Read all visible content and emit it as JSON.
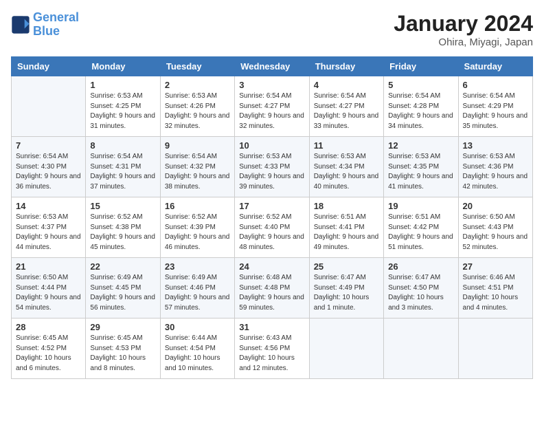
{
  "header": {
    "logo_line1": "General",
    "logo_line2": "Blue",
    "title": "January 2024",
    "subtitle": "Ohira, Miyagi, Japan"
  },
  "days_of_week": [
    "Sunday",
    "Monday",
    "Tuesday",
    "Wednesday",
    "Thursday",
    "Friday",
    "Saturday"
  ],
  "weeks": [
    [
      {
        "num": "",
        "sunrise": "",
        "sunset": "",
        "daylight": ""
      },
      {
        "num": "1",
        "sunrise": "Sunrise: 6:53 AM",
        "sunset": "Sunset: 4:25 PM",
        "daylight": "Daylight: 9 hours and 31 minutes."
      },
      {
        "num": "2",
        "sunrise": "Sunrise: 6:53 AM",
        "sunset": "Sunset: 4:26 PM",
        "daylight": "Daylight: 9 hours and 32 minutes."
      },
      {
        "num": "3",
        "sunrise": "Sunrise: 6:54 AM",
        "sunset": "Sunset: 4:27 PM",
        "daylight": "Daylight: 9 hours and 32 minutes."
      },
      {
        "num": "4",
        "sunrise": "Sunrise: 6:54 AM",
        "sunset": "Sunset: 4:27 PM",
        "daylight": "Daylight: 9 hours and 33 minutes."
      },
      {
        "num": "5",
        "sunrise": "Sunrise: 6:54 AM",
        "sunset": "Sunset: 4:28 PM",
        "daylight": "Daylight: 9 hours and 34 minutes."
      },
      {
        "num": "6",
        "sunrise": "Sunrise: 6:54 AM",
        "sunset": "Sunset: 4:29 PM",
        "daylight": "Daylight: 9 hours and 35 minutes."
      }
    ],
    [
      {
        "num": "7",
        "sunrise": "Sunrise: 6:54 AM",
        "sunset": "Sunset: 4:30 PM",
        "daylight": "Daylight: 9 hours and 36 minutes."
      },
      {
        "num": "8",
        "sunrise": "Sunrise: 6:54 AM",
        "sunset": "Sunset: 4:31 PM",
        "daylight": "Daylight: 9 hours and 37 minutes."
      },
      {
        "num": "9",
        "sunrise": "Sunrise: 6:54 AM",
        "sunset": "Sunset: 4:32 PM",
        "daylight": "Daylight: 9 hours and 38 minutes."
      },
      {
        "num": "10",
        "sunrise": "Sunrise: 6:53 AM",
        "sunset": "Sunset: 4:33 PM",
        "daylight": "Daylight: 9 hours and 39 minutes."
      },
      {
        "num": "11",
        "sunrise": "Sunrise: 6:53 AM",
        "sunset": "Sunset: 4:34 PM",
        "daylight": "Daylight: 9 hours and 40 minutes."
      },
      {
        "num": "12",
        "sunrise": "Sunrise: 6:53 AM",
        "sunset": "Sunset: 4:35 PM",
        "daylight": "Daylight: 9 hours and 41 minutes."
      },
      {
        "num": "13",
        "sunrise": "Sunrise: 6:53 AM",
        "sunset": "Sunset: 4:36 PM",
        "daylight": "Daylight: 9 hours and 42 minutes."
      }
    ],
    [
      {
        "num": "14",
        "sunrise": "Sunrise: 6:53 AM",
        "sunset": "Sunset: 4:37 PM",
        "daylight": "Daylight: 9 hours and 44 minutes."
      },
      {
        "num": "15",
        "sunrise": "Sunrise: 6:52 AM",
        "sunset": "Sunset: 4:38 PM",
        "daylight": "Daylight: 9 hours and 45 minutes."
      },
      {
        "num": "16",
        "sunrise": "Sunrise: 6:52 AM",
        "sunset": "Sunset: 4:39 PM",
        "daylight": "Daylight: 9 hours and 46 minutes."
      },
      {
        "num": "17",
        "sunrise": "Sunrise: 6:52 AM",
        "sunset": "Sunset: 4:40 PM",
        "daylight": "Daylight: 9 hours and 48 minutes."
      },
      {
        "num": "18",
        "sunrise": "Sunrise: 6:51 AM",
        "sunset": "Sunset: 4:41 PM",
        "daylight": "Daylight: 9 hours and 49 minutes."
      },
      {
        "num": "19",
        "sunrise": "Sunrise: 6:51 AM",
        "sunset": "Sunset: 4:42 PM",
        "daylight": "Daylight: 9 hours and 51 minutes."
      },
      {
        "num": "20",
        "sunrise": "Sunrise: 6:50 AM",
        "sunset": "Sunset: 4:43 PM",
        "daylight": "Daylight: 9 hours and 52 minutes."
      }
    ],
    [
      {
        "num": "21",
        "sunrise": "Sunrise: 6:50 AM",
        "sunset": "Sunset: 4:44 PM",
        "daylight": "Daylight: 9 hours and 54 minutes."
      },
      {
        "num": "22",
        "sunrise": "Sunrise: 6:49 AM",
        "sunset": "Sunset: 4:45 PM",
        "daylight": "Daylight: 9 hours and 56 minutes."
      },
      {
        "num": "23",
        "sunrise": "Sunrise: 6:49 AM",
        "sunset": "Sunset: 4:46 PM",
        "daylight": "Daylight: 9 hours and 57 minutes."
      },
      {
        "num": "24",
        "sunrise": "Sunrise: 6:48 AM",
        "sunset": "Sunset: 4:48 PM",
        "daylight": "Daylight: 9 hours and 59 minutes."
      },
      {
        "num": "25",
        "sunrise": "Sunrise: 6:47 AM",
        "sunset": "Sunset: 4:49 PM",
        "daylight": "Daylight: 10 hours and 1 minute."
      },
      {
        "num": "26",
        "sunrise": "Sunrise: 6:47 AM",
        "sunset": "Sunset: 4:50 PM",
        "daylight": "Daylight: 10 hours and 3 minutes."
      },
      {
        "num": "27",
        "sunrise": "Sunrise: 6:46 AM",
        "sunset": "Sunset: 4:51 PM",
        "daylight": "Daylight: 10 hours and 4 minutes."
      }
    ],
    [
      {
        "num": "28",
        "sunrise": "Sunrise: 6:45 AM",
        "sunset": "Sunset: 4:52 PM",
        "daylight": "Daylight: 10 hours and 6 minutes."
      },
      {
        "num": "29",
        "sunrise": "Sunrise: 6:45 AM",
        "sunset": "Sunset: 4:53 PM",
        "daylight": "Daylight: 10 hours and 8 minutes."
      },
      {
        "num": "30",
        "sunrise": "Sunrise: 6:44 AM",
        "sunset": "Sunset: 4:54 PM",
        "daylight": "Daylight: 10 hours and 10 minutes."
      },
      {
        "num": "31",
        "sunrise": "Sunrise: 6:43 AM",
        "sunset": "Sunset: 4:56 PM",
        "daylight": "Daylight: 10 hours and 12 minutes."
      },
      {
        "num": "",
        "sunrise": "",
        "sunset": "",
        "daylight": ""
      },
      {
        "num": "",
        "sunrise": "",
        "sunset": "",
        "daylight": ""
      },
      {
        "num": "",
        "sunrise": "",
        "sunset": "",
        "daylight": ""
      }
    ]
  ]
}
